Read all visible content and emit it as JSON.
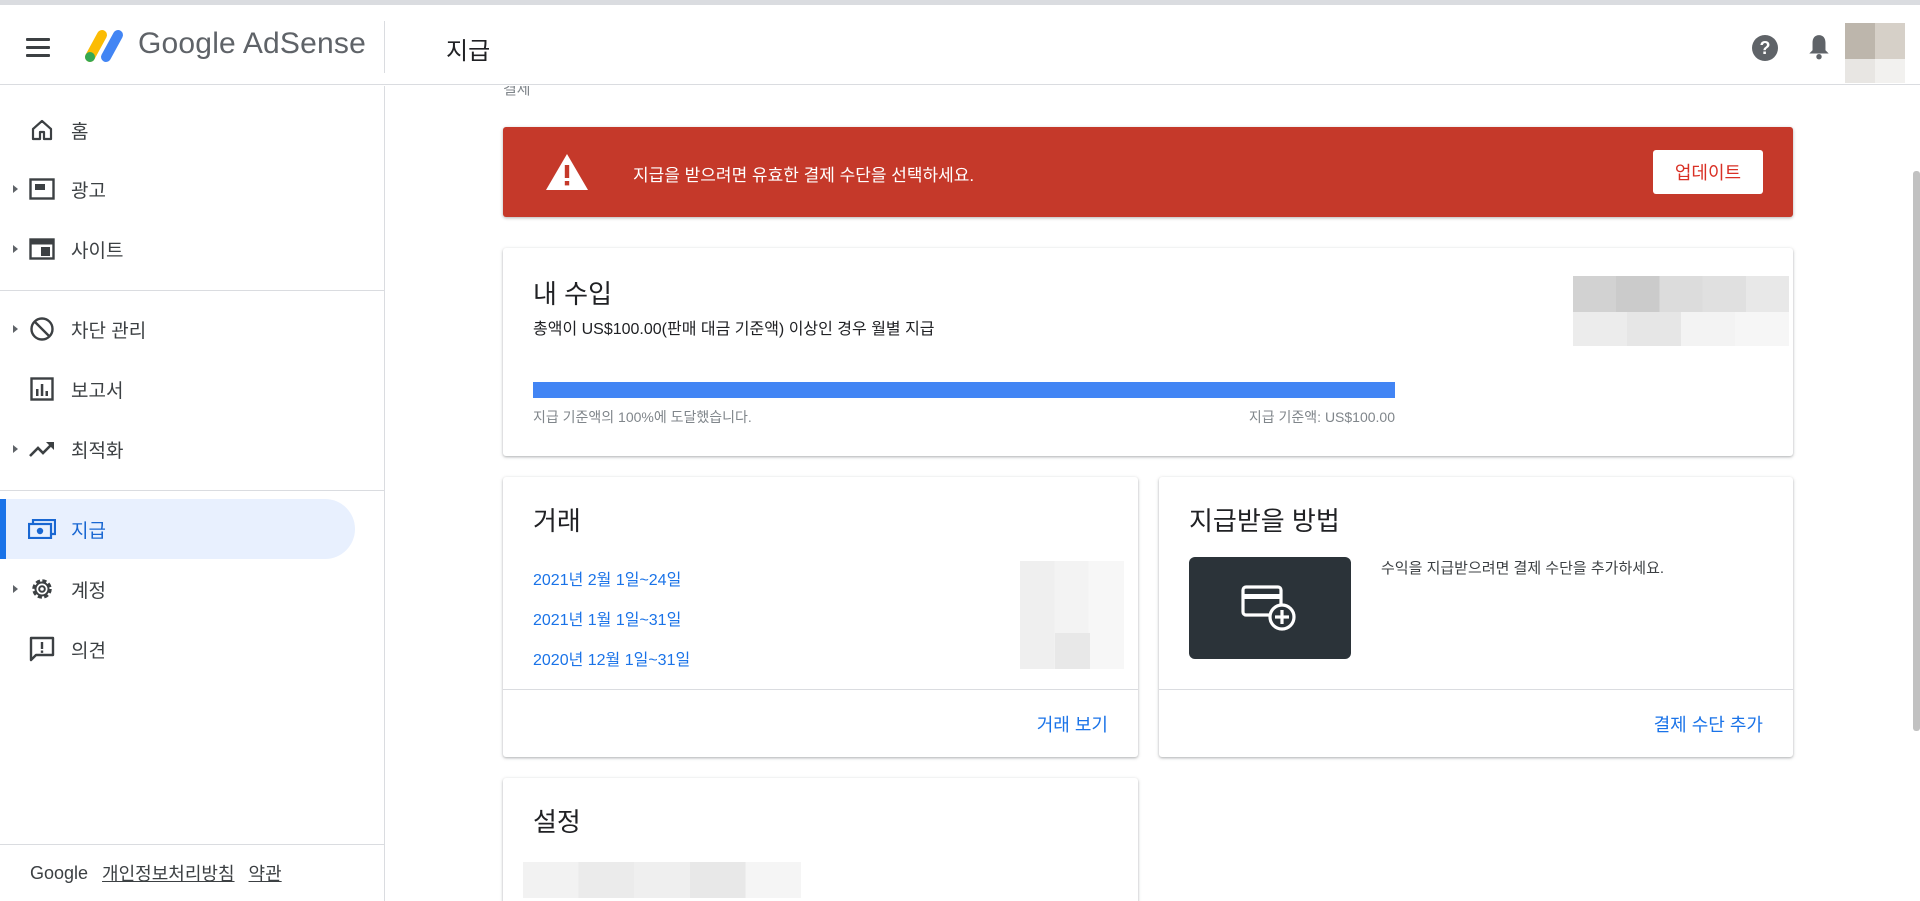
{
  "header": {
    "brand": "Google AdSense",
    "page_title": "지급"
  },
  "sidebar": {
    "items": [
      {
        "label": "홈",
        "icon": "home-icon"
      },
      {
        "label": "광고",
        "icon": "ads-icon"
      },
      {
        "label": "사이트",
        "icon": "sites-icon"
      },
      {
        "label": "차단 관리",
        "icon": "block-icon"
      },
      {
        "label": "보고서",
        "icon": "reports-icon"
      },
      {
        "label": "최적화",
        "icon": "trending-icon"
      },
      {
        "label": "지급",
        "icon": "payments-icon"
      },
      {
        "label": "계정",
        "icon": "gear-icon"
      },
      {
        "label": "의견",
        "icon": "feedback-icon"
      }
    ],
    "footer": {
      "google": "Google",
      "privacy": "개인정보처리방침",
      "terms": "약관"
    }
  },
  "content": {
    "breadcrumb": "결제",
    "alert": {
      "message": "지급을 받으려면 유효한 결제 수단을 선택하세요.",
      "button": "업데이트"
    },
    "earnings": {
      "title": "내 수입",
      "subtitle": "총액이 US$100.00(판매 대금 기준액) 이상인 경우 월별 지급",
      "progress_percent": 100,
      "progress_left": "지급 기준액의 100%에 도달했습니다.",
      "progress_right": "지급 기준액: US$100.00"
    },
    "transactions": {
      "title": "거래",
      "links": [
        "2021년 2월 1일~24일",
        "2021년 1월 1일~31일",
        "2020년 12월 1일~31일"
      ],
      "action": "거래 보기"
    },
    "payment_method": {
      "title": "지급받을 방법",
      "text": "수익을 지급받으려면 결제 수단을 추가하세요.",
      "action": "결제 수단 추가"
    },
    "settings": {
      "title": "설정"
    }
  },
  "colors": {
    "alert_bg": "#c5392a",
    "accent": "#1a73e8",
    "progress": "#4285f4"
  }
}
